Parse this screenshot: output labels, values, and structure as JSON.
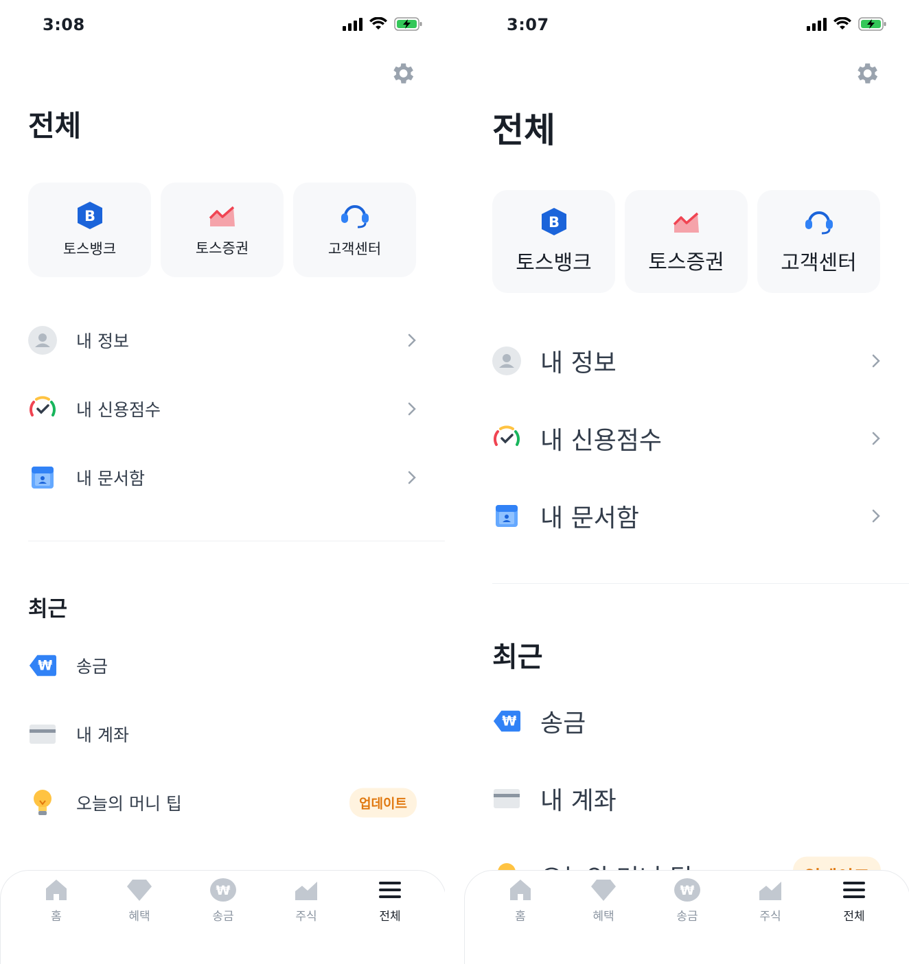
{
  "screens": [
    {
      "status_time": "3:08",
      "page_title": "전체",
      "tiles": [
        {
          "label": "토스뱅크",
          "icon": "toss-bank-icon"
        },
        {
          "label": "토스증권",
          "icon": "toss-securities-icon"
        },
        {
          "label": "고객센터",
          "icon": "headset-icon"
        }
      ],
      "menu": [
        {
          "label": "내 정보",
          "icon": "profile-icon"
        },
        {
          "label": "내 신용점수",
          "icon": "credit-score-icon"
        },
        {
          "label": "내 문서함",
          "icon": "document-box-icon"
        }
      ],
      "recent_title": "최근",
      "recent": [
        {
          "label": "송금",
          "icon": "transfer-icon"
        },
        {
          "label": "내 계좌",
          "icon": "card-icon"
        },
        {
          "label": "오늘의 머니 팁",
          "icon": "lightbulb-icon",
          "badge": "업데이트"
        }
      ]
    },
    {
      "status_time": "3:07",
      "page_title": "전체",
      "tiles": [
        {
          "label": "토스뱅크",
          "icon": "toss-bank-icon"
        },
        {
          "label": "토스증권",
          "icon": "toss-securities-icon"
        },
        {
          "label": "고객센터",
          "icon": "headset-icon"
        }
      ],
      "menu": [
        {
          "label": "내 정보",
          "icon": "profile-icon"
        },
        {
          "label": "내 신용점수",
          "icon": "credit-score-icon"
        },
        {
          "label": "내 문서함",
          "icon": "document-box-icon"
        }
      ],
      "recent_title": "최근",
      "recent": [
        {
          "label": "송금",
          "icon": "transfer-icon"
        },
        {
          "label": "내 계좌",
          "icon": "card-icon"
        },
        {
          "label": "오늘의 머니 팁",
          "icon": "lightbulb-icon",
          "badge": "업데이트"
        }
      ]
    }
  ],
  "tabbar": [
    {
      "label": "홈",
      "icon": "home-icon"
    },
    {
      "label": "혜택",
      "icon": "diamond-icon"
    },
    {
      "label": "송금",
      "icon": "won-icon"
    },
    {
      "label": "주식",
      "icon": "chart-icon"
    },
    {
      "label": "전체",
      "icon": "menu-icon",
      "active": true
    }
  ],
  "colors": {
    "blue": "#3182f6",
    "gray_icon": "#c2c8d0",
    "badge_bg": "#fff3df",
    "badge_text": "#e0780f"
  }
}
